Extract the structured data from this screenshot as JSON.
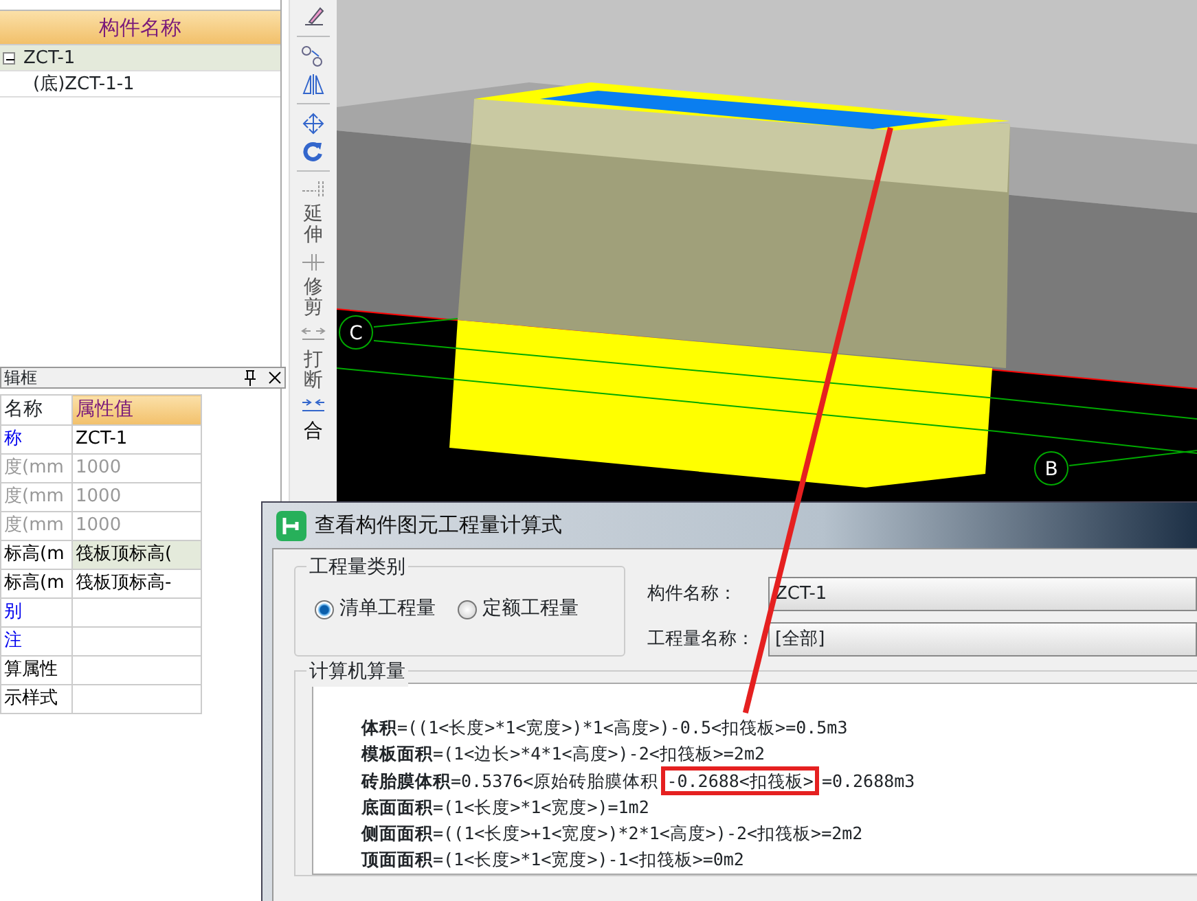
{
  "tree_panel": {
    "header": "构件名称",
    "items": [
      {
        "label": "ZCT-1",
        "expanded": true,
        "selected": true,
        "children": [
          {
            "label": "(底)ZCT-1-1",
            "selected": false
          }
        ]
      }
    ]
  },
  "toolbar": {
    "labels": [
      "延伸",
      "修剪",
      "打断",
      "合"
    ]
  },
  "property_panel": {
    "title": "辑框",
    "columns": [
      "名称",
      "属性值"
    ],
    "rows": [
      {
        "name": "称",
        "value": "ZCT-1",
        "kind": "public",
        "selected": false
      },
      {
        "name": "度(mm",
        "value": "1000",
        "kind": "readonly",
        "selected": false
      },
      {
        "name": "度(mm",
        "value": "1000",
        "kind": "readonly",
        "selected": false
      },
      {
        "name": "度(mm",
        "value": "1000",
        "kind": "readonly",
        "selected": false
      },
      {
        "name": "标高(m",
        "value": "筏板顶标高(",
        "kind": "private",
        "selected": true
      },
      {
        "name": "标高(m",
        "value": "筏板顶标高-",
        "kind": "private",
        "selected": false
      },
      {
        "name": "别",
        "value": "",
        "kind": "public",
        "selected": false
      },
      {
        "name": "注",
        "value": "",
        "kind": "public",
        "selected": false
      },
      {
        "name": "算属性",
        "value": "",
        "kind": "private",
        "selected": false
      },
      {
        "name": "示样式",
        "value": "",
        "kind": "private",
        "selected": false
      }
    ]
  },
  "viewport": {
    "axis_labels": [
      "C",
      "B"
    ]
  },
  "dialog": {
    "title": "查看构件图元工程量计算式",
    "quantity_type": {
      "label": "工程量类别",
      "options": [
        {
          "label": "清单工程量",
          "selected": true
        },
        {
          "label": "定额工程量",
          "selected": false
        }
      ]
    },
    "component_name": {
      "label": "构件名称：",
      "value": "ZCT-1"
    },
    "quantity_name": {
      "label": "工程量名称：",
      "value": "[全部]"
    },
    "calculation": {
      "label": "计算机算量",
      "lines": [
        {
          "text": "**体积**=((1<长度>*1<宽度>)*1<高度>)-0.5<扣筏板>=0.5m3"
        },
        {
          "text": "**模板面积**=(1<边长>*4*1<高度>)-2<扣筏板>=2m2"
        },
        {
          "text": "**砖胎膜体积**=0.5376<原始砖胎膜体积",
          "marked": "-0.2688<扣筏板>",
          "after": "=0.2688m3"
        },
        {
          "text": "**底面面积**=(1<长度>*1<宽度>)=1m2"
        },
        {
          "text": "**侧面面积**=((1<长度>+1<宽度>)*2*1<高度>)-2<扣筏板>=2m2"
        },
        {
          "text": "**顶面面积**=(1<长度>*1<宽度>)-1<扣筏板>=0m2"
        }
      ]
    }
  }
}
